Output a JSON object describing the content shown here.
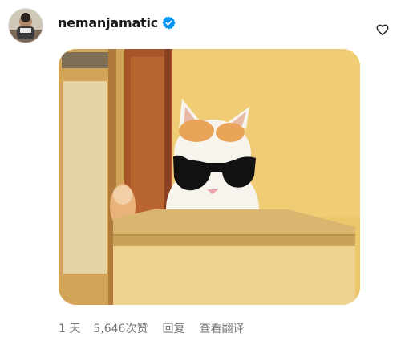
{
  "comment": {
    "username": "nemanjamatic",
    "verified": true,
    "age": "1 天",
    "likes": "5,646次赞",
    "reply_label": "回复",
    "translate_label": "查看翻译"
  },
  "media": {
    "description_icon": "cat-with-sunglasses-in-box-image"
  },
  "icons": {
    "verified": "verified-badge-icon",
    "like": "heart-outline-icon"
  },
  "colors": {
    "verified_blue": "#0095f6",
    "muted_text": "#737373",
    "username_text": "#1a1a1a"
  }
}
